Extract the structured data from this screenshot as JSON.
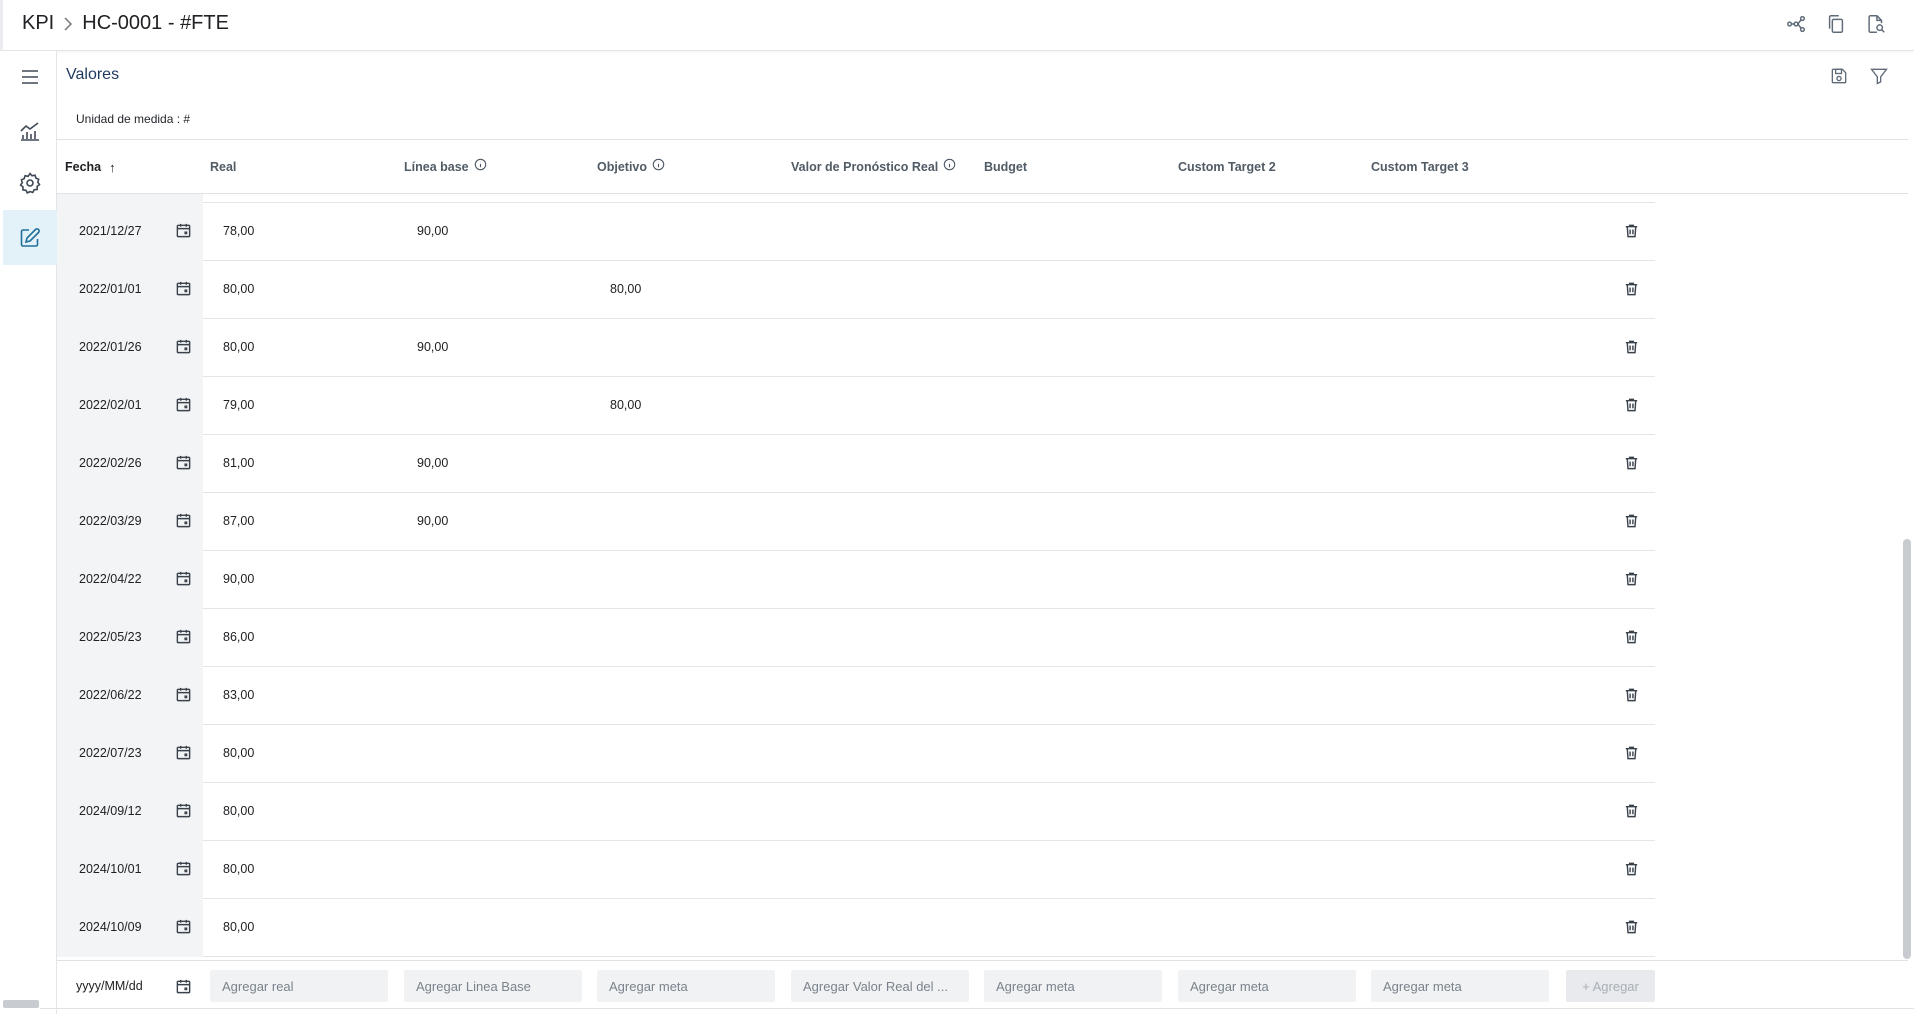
{
  "header": {
    "breadcrumb_root": "KPI",
    "breadcrumb_current": "HC-0001 - #FTE"
  },
  "section": {
    "title": "Valores",
    "unit_label": "Unidad de medida : #"
  },
  "table": {
    "columns": {
      "fecha": "Fecha",
      "sort_indicator": "↑",
      "real": "Real",
      "linea_base": "Línea base",
      "objetivo": "Objetivo",
      "pronostico": "Valor de Pronóstico Real",
      "budget": "Budget",
      "custom2": "Custom Target 2",
      "custom3": "Custom Target 3"
    },
    "rows": [
      {
        "fecha": "2021/12/27",
        "real": "78,00",
        "linea_base": "90,00",
        "objetivo": ""
      },
      {
        "fecha": "2022/01/01",
        "real": "80,00",
        "linea_base": "",
        "objetivo": "80,00"
      },
      {
        "fecha": "2022/01/26",
        "real": "80,00",
        "linea_base": "90,00",
        "objetivo": ""
      },
      {
        "fecha": "2022/02/01",
        "real": "79,00",
        "linea_base": "",
        "objetivo": "80,00"
      },
      {
        "fecha": "2022/02/26",
        "real": "81,00",
        "linea_base": "90,00",
        "objetivo": ""
      },
      {
        "fecha": "2022/03/29",
        "real": "87,00",
        "linea_base": "90,00",
        "objetivo": ""
      },
      {
        "fecha": "2022/04/22",
        "real": "90,00",
        "linea_base": "",
        "objetivo": ""
      },
      {
        "fecha": "2022/05/23",
        "real": "86,00",
        "linea_base": "",
        "objetivo": ""
      },
      {
        "fecha": "2022/06/22",
        "real": "83,00",
        "linea_base": "",
        "objetivo": ""
      },
      {
        "fecha": "2022/07/23",
        "real": "80,00",
        "linea_base": "",
        "objetivo": ""
      },
      {
        "fecha": "2024/09/12",
        "real": "80,00",
        "linea_base": "",
        "objetivo": ""
      },
      {
        "fecha": "2024/10/01",
        "real": "80,00",
        "linea_base": "",
        "objetivo": ""
      },
      {
        "fecha": "2024/10/09",
        "real": "80,00",
        "linea_base": "",
        "objetivo": ""
      }
    ]
  },
  "add_row": {
    "date_placeholder": "yyyy/MM/dd",
    "real_placeholder": "Agregar real",
    "linea_base_placeholder": "Agregar Linea Base",
    "objetivo_placeholder": "Agregar meta",
    "pronostico_placeholder": "Agregar Valor Real del ...",
    "budget_placeholder": "Agregar meta",
    "custom2_placeholder": "Agregar meta",
    "custom3_placeholder": "Agregar meta",
    "add_button_label": "+ Agregar"
  },
  "icons": {
    "top_actions": [
      "network-icon",
      "copy-icon",
      "document-search-icon"
    ],
    "section_actions": [
      "save-icon",
      "filter-icon"
    ],
    "rail": [
      "menu-icon",
      "chart-icon",
      "settings-icon",
      "edit-icon"
    ]
  },
  "colors": {
    "accent_active_bg": "#e3f2f8",
    "accent_active_icon": "#1f6f99",
    "title": "#1e3a5f"
  }
}
